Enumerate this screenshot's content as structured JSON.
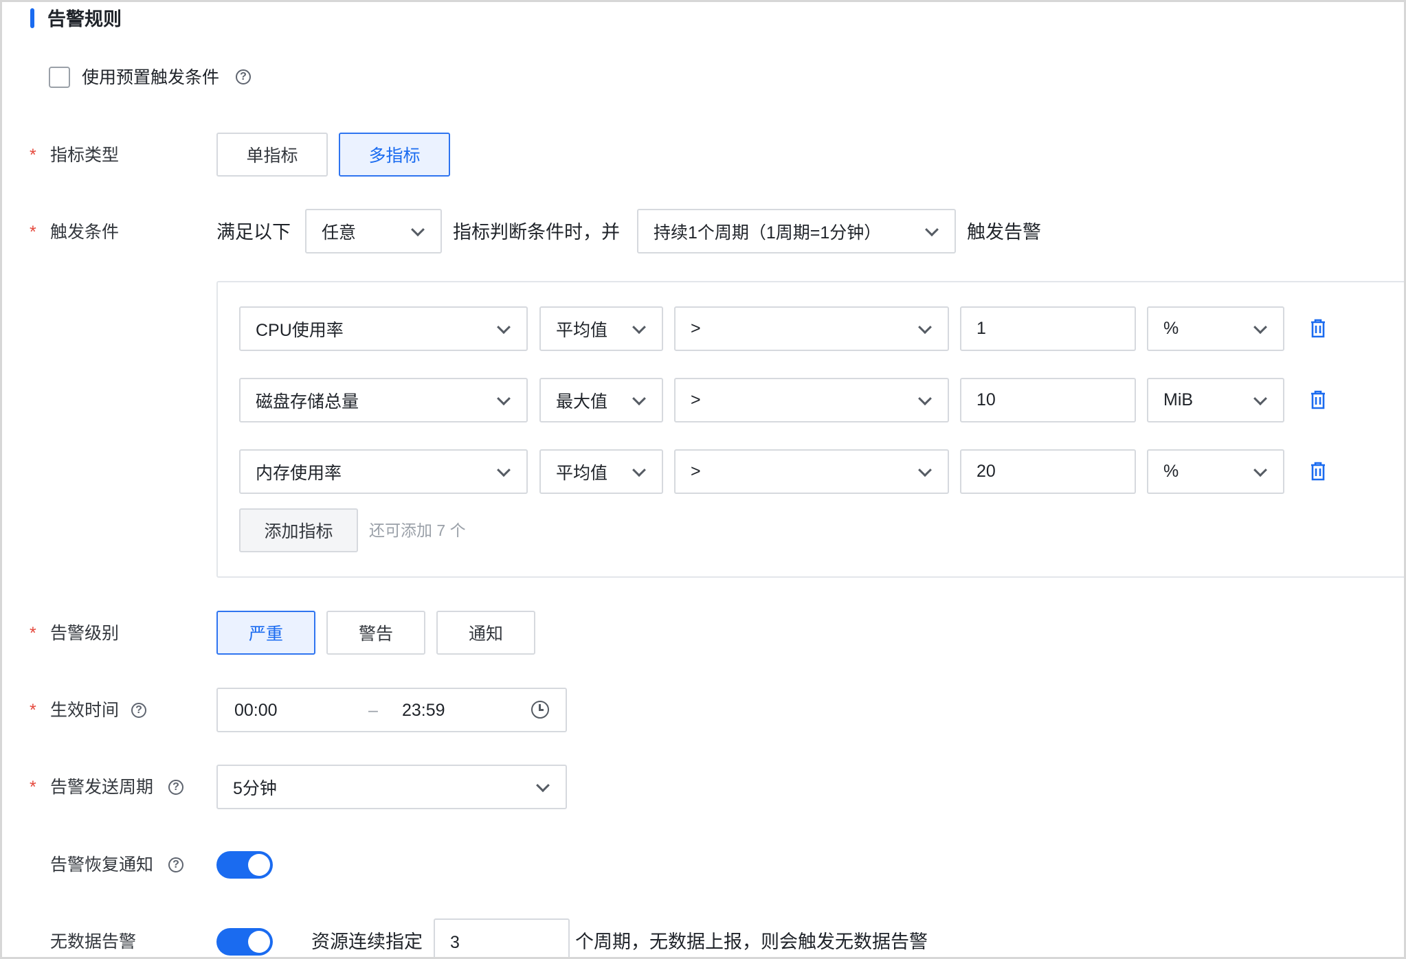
{
  "section": {
    "title": "告警规则"
  },
  "preset": {
    "label": "使用预置触发条件",
    "checked": false
  },
  "metric_type": {
    "label": "指标类型",
    "options": [
      "单指标",
      "多指标"
    ],
    "selected": "多指标"
  },
  "trigger": {
    "label": "触发条件",
    "prefix": "满足以下",
    "match_value": "任意",
    "middle": "指标判断条件时，并",
    "duration_value": "持续1个周期（1周期=1分钟）",
    "suffix": "触发告警"
  },
  "conditions": [
    {
      "metric": "CPU使用率",
      "stat": "平均值",
      "operator": ">",
      "threshold": "1",
      "unit": "%"
    },
    {
      "metric": "磁盘存储总量",
      "stat": "最大值",
      "operator": ">",
      "threshold": "10",
      "unit": "MiB"
    },
    {
      "metric": "内存使用率",
      "stat": "平均值",
      "operator": ">",
      "threshold": "20",
      "unit": "%"
    }
  ],
  "add_metric": {
    "label": "添加指标",
    "hint": "还可添加 7 个"
  },
  "alarm_level": {
    "label": "告警级别",
    "options": [
      "严重",
      "警告",
      "通知"
    ],
    "selected": "严重"
  },
  "effective_time": {
    "label": "生效时间",
    "start": "00:00",
    "separator": "–",
    "end": "23:59"
  },
  "send_period": {
    "label": "告警发送周期",
    "value": "5分钟"
  },
  "recovery_notice": {
    "label": "告警恢复通知",
    "enabled": true
  },
  "no_data": {
    "label": "无数据告警",
    "enabled": true,
    "prefix": "资源连续指定",
    "value": "3",
    "suffix": "个周期，无数据上报，则会触发无数据告警"
  },
  "colors": {
    "accent": "#1a6bf0",
    "required": "#e5483c",
    "border": "#d6d9de"
  },
  "icons": [
    "help-icon",
    "chevron-down-icon",
    "trash-icon",
    "clock-icon"
  ]
}
